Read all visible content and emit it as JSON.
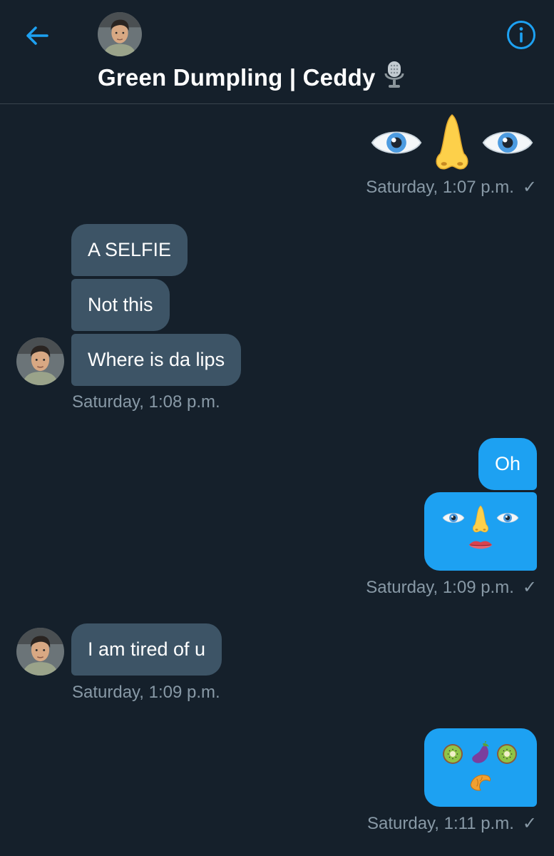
{
  "header": {
    "title": "Green Dumpling | Ceddy",
    "back_icon": "arrow-left-icon",
    "info_icon": "info-icon",
    "title_icon": "microphone-icon",
    "accent": "#1da1f2"
  },
  "messages": [
    {
      "direction": "out",
      "emoji": [
        "eye",
        "nose",
        "eye"
      ],
      "timestamp": "Saturday, 1:07 p.m.",
      "check": "✓"
    },
    {
      "direction": "in",
      "texts": [
        "A SELFIE",
        "Not this",
        "Where is da lips"
      ],
      "timestamp": "Saturday, 1:08 p.m."
    },
    {
      "direction": "out",
      "texts": [
        "Oh"
      ],
      "emoji_bubble": [
        "eye",
        "nose",
        "eye",
        "lips"
      ],
      "timestamp": "Saturday, 1:09 p.m.",
      "check": "✓"
    },
    {
      "direction": "in",
      "texts": [
        "I am tired of u"
      ],
      "timestamp": "Saturday, 1:09 p.m."
    },
    {
      "direction": "out",
      "emoji_bubble": [
        "kiwi",
        "eggplant",
        "kiwi",
        "croissant"
      ],
      "timestamp": "Saturday, 1:11 p.m.",
      "check": "✓"
    }
  ],
  "colors": {
    "background": "#15202b",
    "incoming_bubble": "#3d5466",
    "outgoing_bubble": "#1da1f2",
    "timestamp": "#8899a6"
  }
}
